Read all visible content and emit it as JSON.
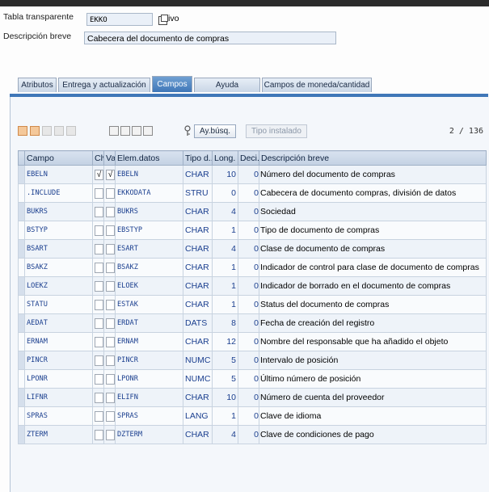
{
  "header": {
    "table_label": "Tabla transparente",
    "table_value": "EKKO",
    "status_text": "ivo",
    "desc_label": "Descripción breve",
    "desc_value": "Cabecera del documento de compras"
  },
  "tabs": [
    {
      "label": "Atributos",
      "active": false
    },
    {
      "label": "Entrega y actualización",
      "active": false
    },
    {
      "label": "Campos",
      "active": true
    },
    {
      "label": "Ayuda p./Verif.entr.",
      "active": false
    },
    {
      "label": "Campos de moneda/cantidad",
      "active": false
    }
  ],
  "toolbar": {
    "search_help_label": "Ay.búsq.",
    "builtin_type_label": "Tipo instalado",
    "counter": "2 / 136"
  },
  "columns": [
    "Campo",
    "Clv",
    "Val...",
    "Elem.datos",
    "Tipo d...",
    "Long.",
    "Deci...",
    "Descripción breve"
  ],
  "rows": [
    {
      "campo": "EBELN",
      "clv": "√",
      "val": "√",
      "elem": "EBELN",
      "tipo": "CHAR",
      "long": "10",
      "deci": "0",
      "desc": "Número del documento de compras"
    },
    {
      "campo": ".INCLUDE",
      "clv": "",
      "val": "",
      "elem": "EKKODATA",
      "tipo": "STRU",
      "long": "0",
      "deci": "0",
      "desc": "Cabecera de documento compras, división de datos"
    },
    {
      "campo": "BUKRS",
      "clv": "",
      "val": "",
      "elem": "BUKRS",
      "tipo": "CHAR",
      "long": "4",
      "deci": "0",
      "desc": "Sociedad"
    },
    {
      "campo": "BSTYP",
      "clv": "",
      "val": "",
      "elem": "EBSTYP",
      "tipo": "CHAR",
      "long": "1",
      "deci": "0",
      "desc": "Tipo de documento de compras"
    },
    {
      "campo": "BSART",
      "clv": "",
      "val": "",
      "elem": "ESART",
      "tipo": "CHAR",
      "long": "4",
      "deci": "0",
      "desc": "Clase de documento de compras"
    },
    {
      "campo": "BSAKZ",
      "clv": "",
      "val": "",
      "elem": "BSAKZ",
      "tipo": "CHAR",
      "long": "1",
      "deci": "0",
      "desc": "Indicador de control para clase de documento de compras"
    },
    {
      "campo": "LOEKZ",
      "clv": "",
      "val": "",
      "elem": "ELOEK",
      "tipo": "CHAR",
      "long": "1",
      "deci": "0",
      "desc": "Indicador de borrado en el documento de compras"
    },
    {
      "campo": "STATU",
      "clv": "",
      "val": "",
      "elem": "ESTAK",
      "tipo": "CHAR",
      "long": "1",
      "deci": "0",
      "desc": "Status del documento de compras"
    },
    {
      "campo": "AEDAT",
      "clv": "",
      "val": "",
      "elem": "ERDAT",
      "tipo": "DATS",
      "long": "8",
      "deci": "0",
      "desc": "Fecha de creación del registro"
    },
    {
      "campo": "ERNAM",
      "clv": "",
      "val": "",
      "elem": "ERNAM",
      "tipo": "CHAR",
      "long": "12",
      "deci": "0",
      "desc": "Nombre del responsable que ha añadido el objeto"
    },
    {
      "campo": "PINCR",
      "clv": "",
      "val": "",
      "elem": "PINCR",
      "tipo": "NUMC",
      "long": "5",
      "deci": "0",
      "desc": "Intervalo de posición"
    },
    {
      "campo": "LPONR",
      "clv": "",
      "val": "",
      "elem": "LPONR",
      "tipo": "NUMC",
      "long": "5",
      "deci": "0",
      "desc": "Último número de posición"
    },
    {
      "campo": "LIFNR",
      "clv": "",
      "val": "",
      "elem": "ELIFN",
      "tipo": "CHAR",
      "long": "10",
      "deci": "0",
      "desc": "Número de cuenta del proveedor"
    },
    {
      "campo": "SPRAS",
      "clv": "",
      "val": "",
      "elem": "SPRAS",
      "tipo": "LANG",
      "long": "1",
      "deci": "0",
      "desc": "Clave de idioma"
    },
    {
      "campo": "ZTERM",
      "clv": "",
      "val": "",
      "elem": "DZTERM",
      "tipo": "CHAR",
      "long": "4",
      "deci": "0",
      "desc": "Clave de condiciones de pago"
    }
  ],
  "colors": {
    "active_tab": "#3f77b8",
    "field_text": "#1b3f8f",
    "header_bg": "#c3d1e3"
  }
}
